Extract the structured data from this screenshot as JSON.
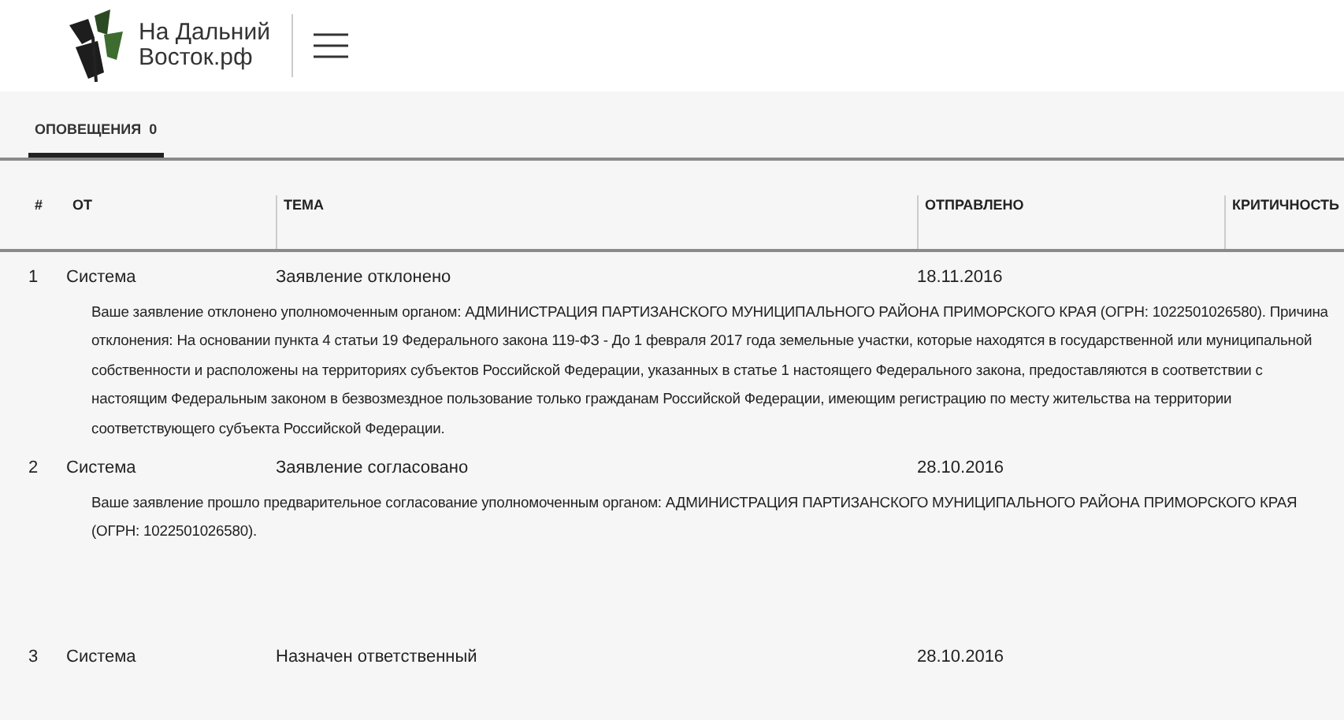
{
  "logo": {
    "line_1": "На Дальний",
    "line_2": "Восток.рф"
  },
  "tabs": [
    {
      "label": "ОПОВЕЩЕНИЯ",
      "count": "0",
      "selected": true
    }
  ],
  "table": {
    "columns": [
      "#",
      "ОТ",
      "ТЕМА",
      "ОТПРАВЛЕНО",
      "КРИТИЧНОСТЬ"
    ],
    "rows": [
      {
        "number": "1",
        "from": "Система",
        "subject": "Заявление отклонено",
        "sent": "18.11.2016",
        "message": "Ваше заявление отклонено уполномоченным органом: АДМИНИСТРАЦИЯ ПАРТИЗАНСКОГО МУНИЦИПАЛЬНОГО РАЙОНА ПРИМОРСКОГО КРАЯ (ОГРН: 1022501026580). Причина отклонения: На основании пункта 4 статьи 19 Федерального закона 119-ФЗ - До 1 февраля 2017 года земельные участки, которые находятся в государственной или муниципальной собственности и расположены на территориях субъектов Российской Федерации, указанных в статье 1 настоящего Федерального закона, предоставляются в соответствии с настоящим Федеральным законом в безвозмездное пользование только гражданам Российской Федерации, имеющим регистрацию по месту жительства на территории соответствующего субъекта Российской Федерации."
      },
      {
        "number": "2",
        "from": "Система",
        "subject": "Заявление согласовано",
        "sent": "28.10.2016",
        "message": "Ваше заявление прошло предварительное согласование уполномоченным органом: АДМИНИСТРАЦИЯ ПАРТИЗАНСКОГО МУНИЦИПАЛЬНОГО РАЙОНА ПРИМОРСКОГО КРАЯ (ОГРН: 1022501026580)."
      },
      {
        "number": "3",
        "from": "Система",
        "subject": "Назначен ответственный",
        "sent": "28.10.2016"
      }
    ]
  }
}
